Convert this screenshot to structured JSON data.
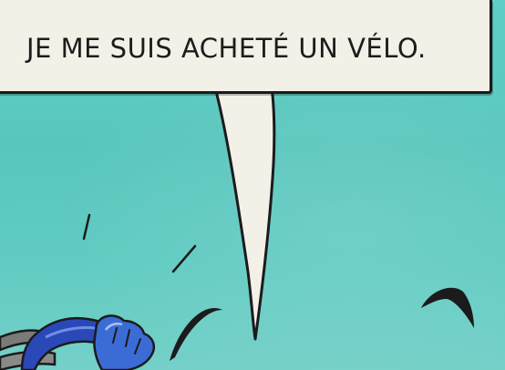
{
  "speech_bubble": {
    "text": "JE ME SUIS ACHETÉ UN VÉLO."
  },
  "colors": {
    "sky": "#5ecfc6",
    "bubble_fill": "#f3f0e8",
    "ink": "#1b1b1b",
    "bike_frame": "#2a48b8"
  }
}
